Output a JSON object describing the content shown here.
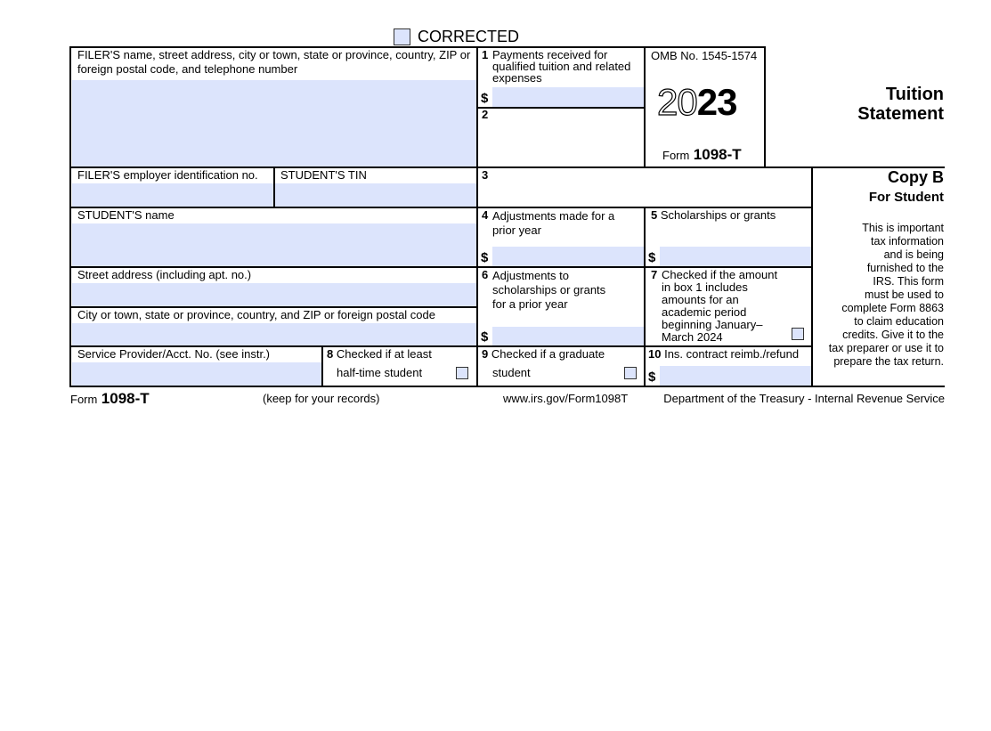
{
  "header": {
    "corrected_label": "CORRECTED",
    "omb": "OMB No. 1545-1574",
    "year_outline": "20",
    "year_bold": "23",
    "form_prefix": "Form",
    "form_number": "1098-T",
    "title_line1": "Tuition",
    "title_line2": "Statement"
  },
  "copy": {
    "title": "Copy B",
    "subtitle": "For Student",
    "notice": [
      "This is important",
      "tax information",
      "and is being",
      "furnished to the",
      "IRS. This form",
      "must be used to",
      "complete Form 8863",
      "to claim education",
      "credits. Give it to the",
      "tax preparer or use it to",
      "prepare the tax return."
    ]
  },
  "fields": {
    "filer_label_l1": "FILER'S name, street address, city or town, state or province, country, ZIP or",
    "filer_label_l2": "foreign postal code, and telephone number",
    "filer_value": "",
    "filer_ein_label": "FILER'S employer identification no.",
    "filer_ein_value": "",
    "student_tin_label": "STUDENT'S TIN",
    "student_tin_value": "",
    "student_name_label": "STUDENT'S name",
    "student_name_value": "",
    "street_label": "Street address (including apt. no.)",
    "street_value": "",
    "city_label": "City or town, state or province, country, and ZIP or foreign postal code",
    "city_value": "",
    "service_provider_label": "Service Provider/Acct. No. (see instr.)",
    "service_provider_value": ""
  },
  "boxes": {
    "b1": {
      "num": "1",
      "lines": [
        "Payments received for",
        "qualified tuition and related",
        "expenses"
      ],
      "value": ""
    },
    "b2": {
      "num": "2"
    },
    "b3": {
      "num": "3"
    },
    "b4": {
      "num": "4",
      "lines": [
        "Adjustments made for a",
        "prior year"
      ],
      "value": ""
    },
    "b5": {
      "num": "5",
      "lines": [
        "Scholarships or grants"
      ],
      "value": ""
    },
    "b6": {
      "num": "6",
      "lines": [
        "Adjustments to",
        "scholarships or grants",
        "for a prior year"
      ],
      "value": ""
    },
    "b7": {
      "num": "7",
      "lines": [
        "Checked if the amount",
        "in box 1 includes",
        "amounts for an",
        "academic period",
        "beginning January–",
        "March 2024"
      ],
      "checked": false
    },
    "b8": {
      "num": "8",
      "lines": [
        "Checked if at least",
        "half-time student"
      ],
      "checked": false
    },
    "b9": {
      "num": "9",
      "lines": [
        "Checked if a graduate",
        "student"
      ],
      "checked": false
    },
    "b10": {
      "num": "10",
      "lines": [
        "Ins. contract reimb./refund"
      ],
      "value": ""
    },
    "dollar_sign": "$"
  },
  "footer": {
    "form_prefix": "Form",
    "form_number": "1098-T",
    "keep": "(keep for your records)",
    "url": "www.irs.gov/Form1098T",
    "department": "Department of the Treasury - Internal Revenue Service"
  },
  "colors": {
    "field_fill": "#dce4fc",
    "line": "#000000"
  }
}
